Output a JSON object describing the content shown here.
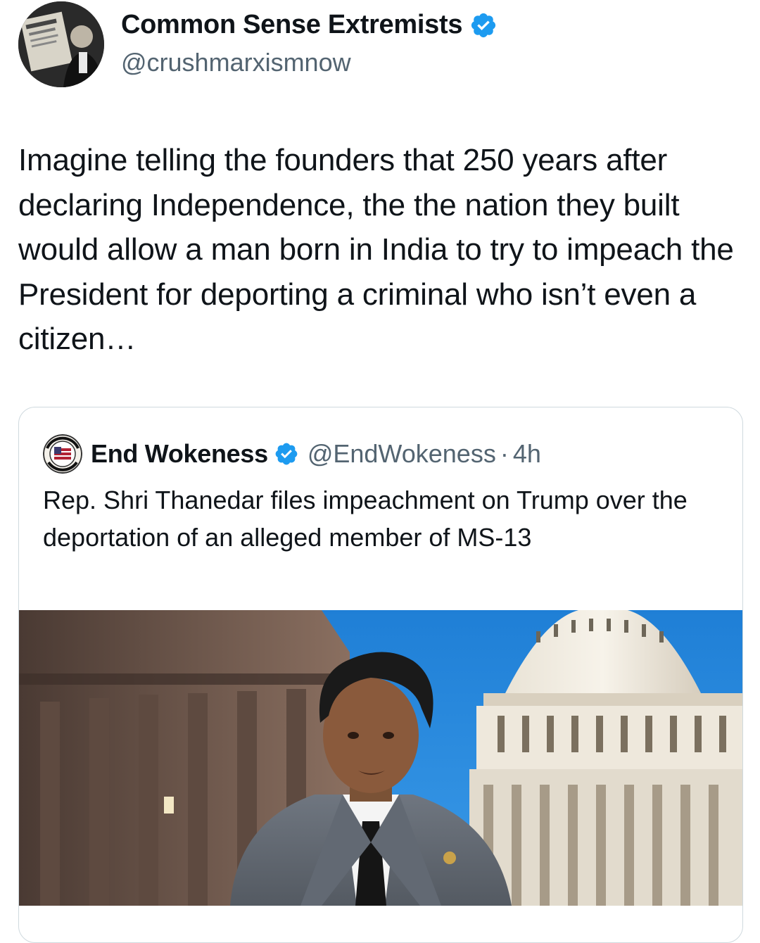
{
  "tweet": {
    "author": {
      "display_name": "Common Sense Extremists",
      "handle": "@crushmarxismnow",
      "verified": true,
      "verified_icon": "verified-badge-icon"
    },
    "text": "Imagine telling the founders that 250 years after declaring Independence, the the nation they built would allow a man born in India to try to impeach the President for deporting a criminal who isn’t even a citizen…"
  },
  "quoted_tweet": {
    "author": {
      "display_name": "End Wokeness",
      "handle": "@EndWokeness",
      "verified": true
    },
    "separator": "·",
    "time": "4h",
    "text": "Rep. Shri Thanedar files impeachment on Trump over the deportation of an alleged member of MS-13",
    "media": {
      "kind": "photo",
      "subject": "man in suit in front of U.S. Capitol"
    }
  },
  "colors": {
    "text_primary": "#0f1419",
    "text_secondary": "#536471",
    "verified_blue": "#1d9bf0",
    "border": "#cfd9de"
  }
}
